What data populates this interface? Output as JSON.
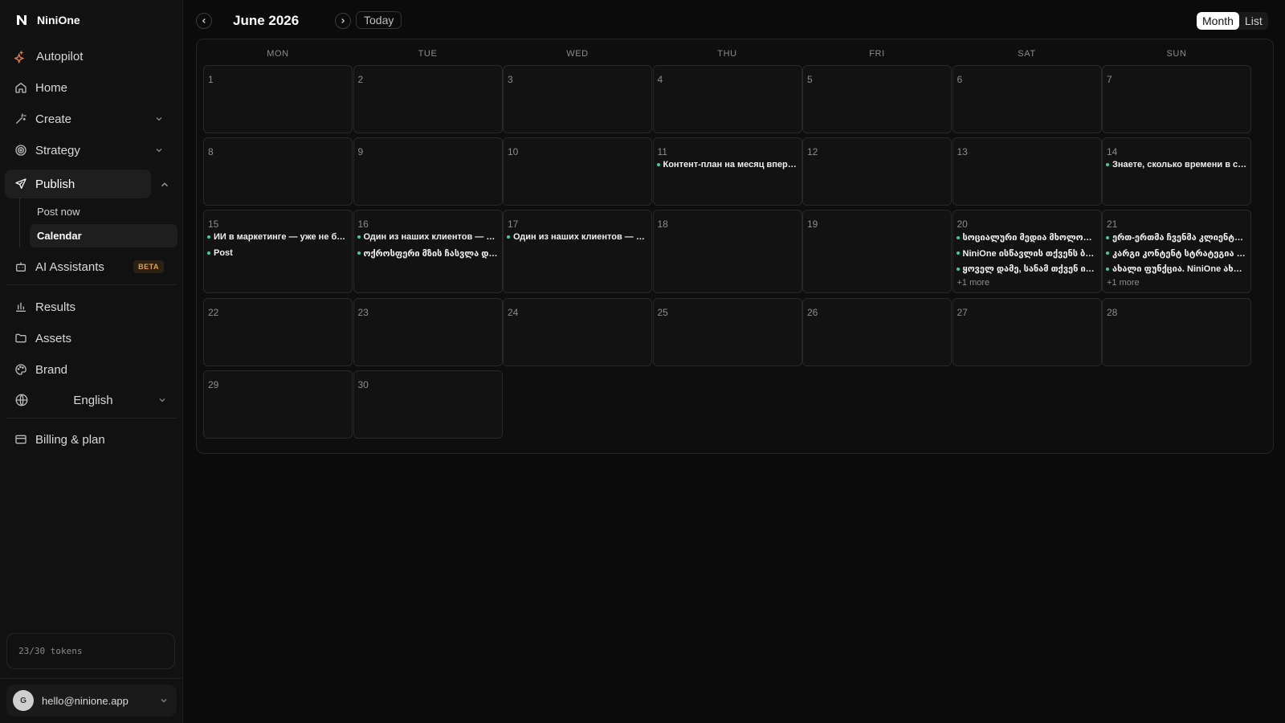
{
  "brand": {
    "name": "NiniOne"
  },
  "nav": {
    "autopilot": "Autopilot",
    "home": "Home",
    "create": "Create",
    "strategy": "Strategy",
    "publish": "Publish",
    "publish_sub": [
      "Post now",
      "Calendar"
    ],
    "ai_assistants": "AI Assistants",
    "beta": "BETA",
    "results": "Results",
    "assets": "Assets",
    "brand": "Brand",
    "language": "English",
    "billing": "Billing & plan"
  },
  "tokens": "23/30 tokens",
  "user": {
    "initial": "G",
    "email": "hello@ninione.app"
  },
  "toolbar": {
    "title": "June 2026",
    "today": "Today",
    "view_month": "Month",
    "view_list": "List"
  },
  "weekdays": [
    "MON",
    "TUE",
    "WED",
    "THU",
    "FRI",
    "SAT",
    "SUN"
  ],
  "days": [
    {
      "n": "1",
      "events": []
    },
    {
      "n": "2",
      "events": []
    },
    {
      "n": "3",
      "events": []
    },
    {
      "n": "4",
      "events": []
    },
    {
      "n": "5",
      "events": []
    },
    {
      "n": "6",
      "events": []
    },
    {
      "n": "7",
      "events": []
    },
    {
      "n": "8",
      "events": []
    },
    {
      "n": "9",
      "events": []
    },
    {
      "n": "10",
      "events": []
    },
    {
      "n": "11",
      "events": [
        "Контент-план на месяц вперё…"
      ]
    },
    {
      "n": "12",
      "events": []
    },
    {
      "n": "13",
      "events": []
    },
    {
      "n": "14",
      "events": [
        "Знаете, сколько времени в сре…"
      ]
    },
    {
      "n": "15",
      "events": [
        "ИИ в маркетинге — уже не буд…",
        "Post"
      ]
    },
    {
      "n": "16",
      "events": [
        "Один из наших клиентов — не…",
        "ოქროსფერი მზის ჩასვლა და ზ…"
      ]
    },
    {
      "n": "17",
      "events": [
        "Один из наших клиентов — не…"
      ]
    },
    {
      "n": "18",
      "events": []
    },
    {
      "n": "19",
      "events": []
    },
    {
      "n": "20",
      "events": [
        "სოციალური მედია მხოლოდ პ…",
        "NiniOne ისწავლის თქვენს ბრე…",
        "ყოველ დამე, სანამ თქვენ ისვე…"
      ],
      "more": "+1 more"
    },
    {
      "n": "21",
      "events": [
        "ერთ-ერთმა ჩვენმა კლიენტმა,…",
        "კარგი კონტენტ სტრატეგია სა…",
        "ახალი ფუნქცია. NiniOne ახლა …"
      ],
      "more": "+1 more"
    },
    {
      "n": "22",
      "events": []
    },
    {
      "n": "23",
      "events": []
    },
    {
      "n": "24",
      "events": []
    },
    {
      "n": "25",
      "events": []
    },
    {
      "n": "26",
      "events": []
    },
    {
      "n": "27",
      "events": []
    },
    {
      "n": "28",
      "events": []
    },
    {
      "n": "29",
      "events": []
    },
    {
      "n": "30",
      "events": []
    }
  ],
  "colors": {
    "accent": "#34d399",
    "beta": "#e2a24a"
  }
}
